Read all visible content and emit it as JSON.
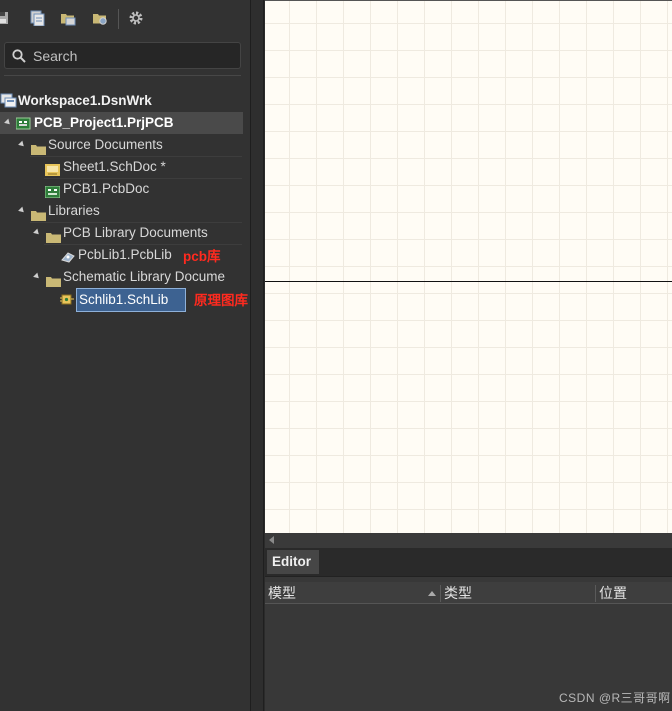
{
  "toolbar": {
    "icons": [
      "save-icon",
      "workspace-documents-icon",
      "folder-open-icon",
      "folder-settings-icon",
      "gear-icon"
    ]
  },
  "search": {
    "placeholder": "Search"
  },
  "tree": {
    "workspace": "Workspace1.DsnWrk",
    "project": "PCB_Project1.PrjPCB",
    "source_folder": "Source Documents",
    "sheet": "Sheet1.SchDoc *",
    "pcb_doc": "PCB1.PcbDoc",
    "libraries_folder": "Libraries",
    "pcb_lib_folder": "PCB Library Documents",
    "pcb_lib": "PcbLib1.PcbLib",
    "sch_lib_folder": "Schematic Library Docume",
    "sch_lib": "Schlib1.SchLib"
  },
  "annotations": {
    "pcb_lib_note": "pcb库",
    "sch_lib_note": "原理图库"
  },
  "editor": {
    "tab_label": "Editor",
    "columns": [
      "模型",
      "类型",
      "位置"
    ]
  },
  "watermark": "CSDN @R三哥哥啊",
  "colors": {
    "canvas_bg": "#fffcf5",
    "selection_bg": "#3d6291",
    "annotation_red": "#ff2a1f",
    "folder_yellow": "#c9b875"
  }
}
